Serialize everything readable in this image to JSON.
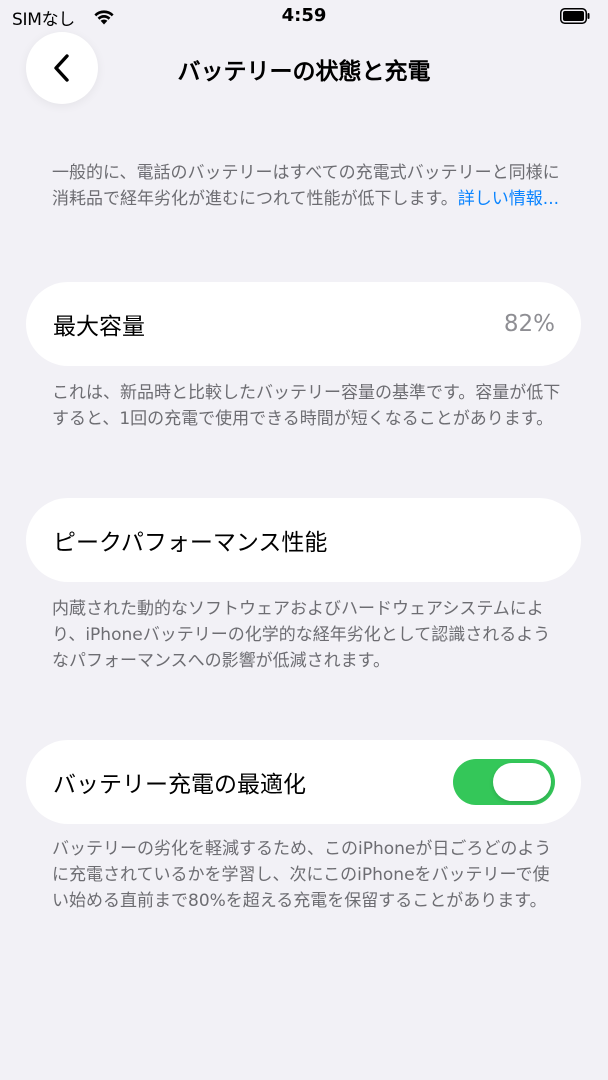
{
  "status_bar": {
    "carrier": "SIMなし",
    "time": "4:59",
    "wifi_icon": "wifi-icon",
    "battery_icon": "battery-icon"
  },
  "nav": {
    "back_icon": "chevron-left-icon",
    "title": "バッテリーの状態と充電"
  },
  "intro": {
    "text": "一般的に、電話のバッテリーはすべての充電式バッテリーと同様に消耗品で経年劣化が進むにつれて性能が低下します。",
    "link": "詳しい情報..."
  },
  "maximum_capacity": {
    "label": "最大容量",
    "value": "82%",
    "footnote": "これは、新品時と比較したバッテリー容量の基準です。容量が低下すると、1回の充電で使用できる時間が短くなることがあります。"
  },
  "peak_performance": {
    "label": "ピークパフォーマンス性能",
    "footnote": "内蔵された動的なソフトウェアおよびハードウェアシステムにより、iPhoneバッテリーの化学的な経年劣化として認識されるようなパフォーマンスへの影響が低減されます。"
  },
  "optimized_charging": {
    "label": "バッテリー充電の最適化",
    "enabled": true,
    "footnote": "バッテリーの劣化を軽減するため、このiPhoneが日ごろどのように充電されているかを学習し、次にこのiPhoneをバッテリーで使い始める直前まで80%を超える充電を保留することがあります。"
  },
  "colors": {
    "background": "#f2f1f6",
    "cell": "#ffffff",
    "secondary_text": "#6d6d72",
    "link": "#0a84ff",
    "toggle_on": "#34c759"
  }
}
